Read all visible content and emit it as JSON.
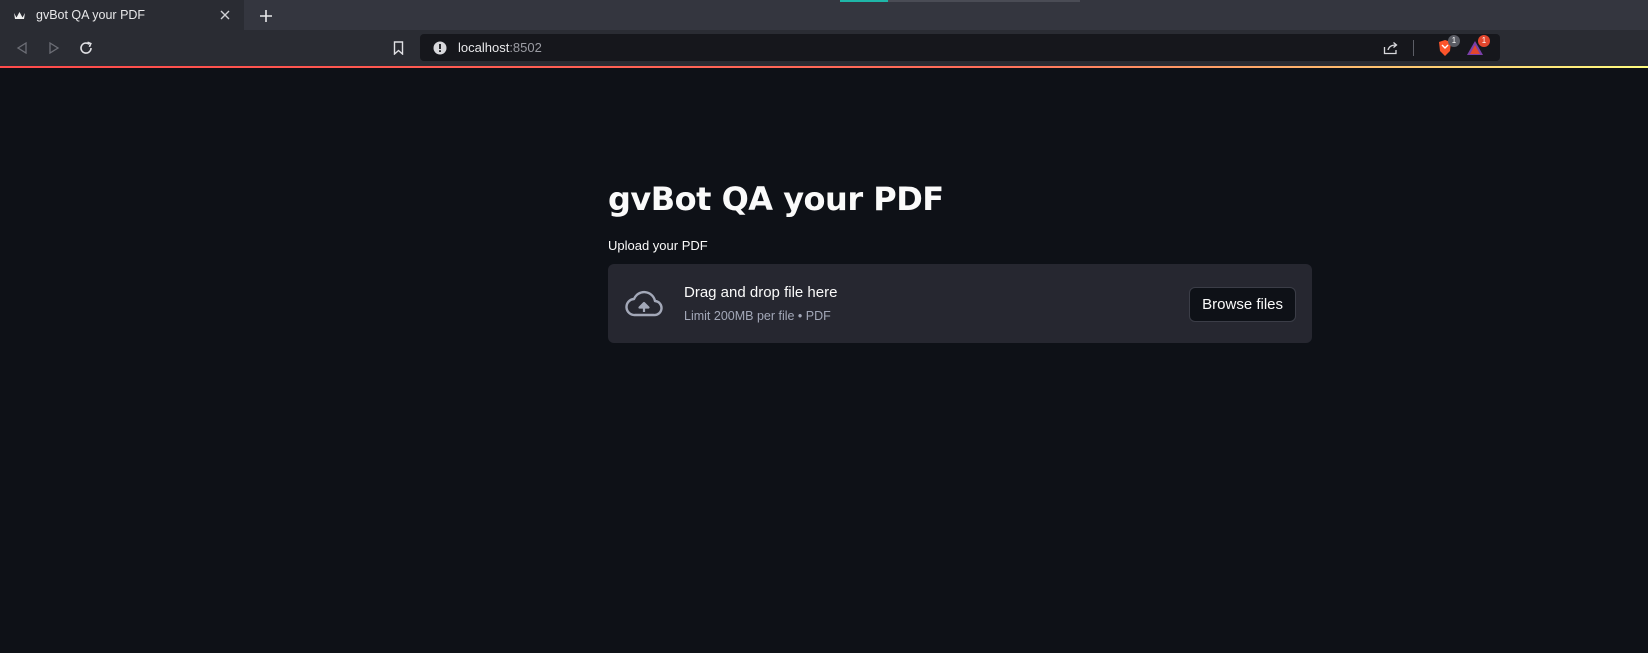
{
  "browser": {
    "tab": {
      "title": "gvBot QA your PDF",
      "favicon": "crown-icon"
    },
    "new_tab_symbol": "+",
    "url": {
      "host": "localhost",
      "port": ":8502"
    },
    "extensions": [
      {
        "name": "brave-shields-icon",
        "badge": "1",
        "color": "#fb542b"
      },
      {
        "name": "brave-rewards-icon",
        "badge": "1",
        "color": "#e2462d"
      }
    ],
    "accent_colors": {
      "loadbar_start": "#ff4b4b",
      "loadbar_end": "#fffd80"
    }
  },
  "app": {
    "title": "gvBot QA your PDF",
    "uploader": {
      "label": "Upload your PDF",
      "drop_text": "Drag and drop file here",
      "limit_text": "Limit 200MB per file • PDF",
      "browse_label": "Browse files",
      "icon": "cloud-upload-icon"
    },
    "colors": {
      "background": "#0e1117",
      "dropzone": "#262730",
      "text": "#fafafa"
    }
  }
}
